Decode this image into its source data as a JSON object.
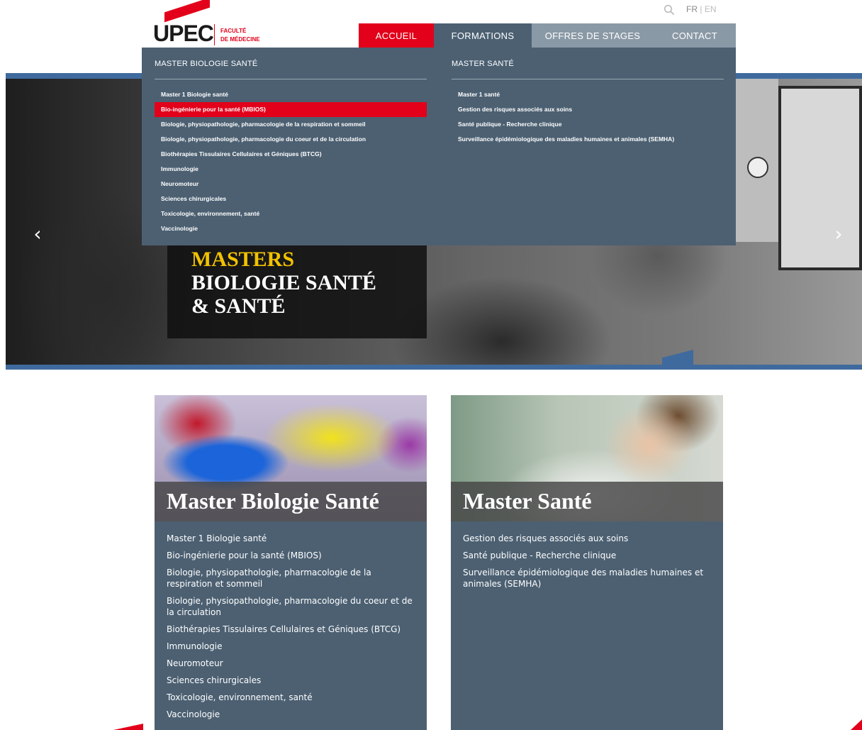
{
  "header": {
    "logo_text": "UPEC",
    "logo_subtitle_1": "FACULTÉ",
    "logo_subtitle_2": "DE MÉDECINE",
    "lang_current": "FR",
    "lang_sep": "|",
    "lang_other": "EN",
    "search_icon": "search-icon"
  },
  "nav": {
    "accueil": "ACCUEIL",
    "formations": "FORMATIONS",
    "stages": "OFFRES DE STAGES",
    "contact": "CONTACT"
  },
  "dropdown": {
    "col1_title": "MASTER BIOLOGIE SANTÉ",
    "col1_items": [
      "Master 1 Biologie santé",
      "Bio-ingénierie pour la santé (MBIOS)",
      "Biologie, physiopathologie, pharmacologie de la respiration et sommeil",
      "Biologie, physiopathologie, pharmacologie du coeur et de la circulation",
      "Biothérapies Tissulaires Cellulaires et Géniques (BTCG)",
      "Immunologie",
      "Neuromoteur",
      "Sciences chirurgicales",
      "Toxicologie, environnement, santé",
      "Vaccinologie"
    ],
    "col2_title": "MASTER SANTÉ",
    "col2_items": [
      "Master 1 santé",
      "Gestion des risques associés aux soins",
      "Santé publique - Recherche clinique",
      "Surveillance épidémiologique des maladies humaines et animales (SEMHA)"
    ]
  },
  "hero": {
    "line1": "MASTERS",
    "line2": "BIOLOGIE SANTÉ",
    "line3": "& SANTÉ",
    "prev_icon": "chevron-left-icon",
    "next_icon": "chevron-right-icon",
    "prev_glyph": "‹",
    "next_glyph": "›"
  },
  "cards": [
    {
      "title": "Master Biologie Santé",
      "items": [
        "Master 1 Biologie santé",
        "Bio-ingénierie pour la santé (MBIOS)",
        "Biologie, physiopathologie, pharmacologie de la respiration et sommeil",
        "Biologie, physiopathologie, pharmacologie du coeur et de la circulation",
        "Biothérapies Tissulaires Cellulaires et Géniques (BTCG)",
        "Immunologie",
        "Neuromoteur",
        "Sciences chirurgicales",
        "Toxicologie, environnement, santé",
        "Vaccinologie"
      ]
    },
    {
      "title": "Master Santé",
      "items": [
        "Gestion des risques associés aux soins",
        "Santé publique - Recherche clinique",
        "Surveillance épidémiologique des maladies humaines et animales (SEMHA)"
      ]
    }
  ],
  "colors": {
    "brand_red": "#e2001a",
    "menu_slate": "#4c6072",
    "nav_grey": "#8a99a6",
    "hero_blue": "#3f6a9e",
    "hero_yellow": "#f2c200"
  }
}
